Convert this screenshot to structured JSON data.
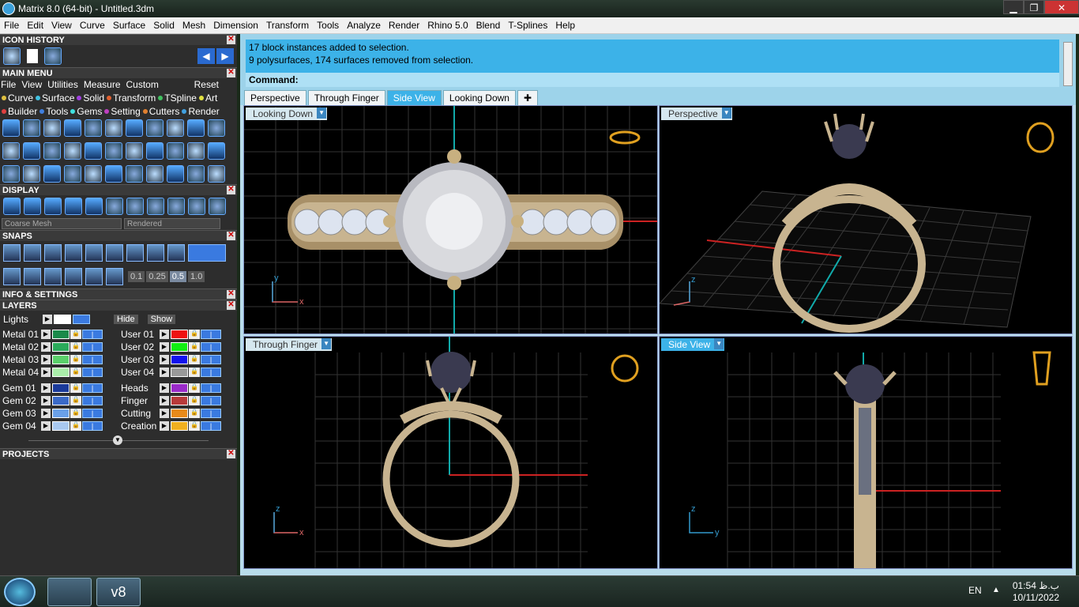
{
  "window": {
    "title": "Matrix 8.0 (64-bit) - Untitled.3dm",
    "min": "▁",
    "max": "❐",
    "close": "✕"
  },
  "menubar": [
    "File",
    "Edit",
    "View",
    "Curve",
    "Surface",
    "Solid",
    "Mesh",
    "Dimension",
    "Transform",
    "Tools",
    "Analyze",
    "Render",
    "Rhino 5.0",
    "Blend",
    "T-Splines",
    "Help"
  ],
  "left": {
    "icon_history": {
      "title": "ICON HISTORY"
    },
    "main_menu": {
      "title": "MAIN MENU",
      "menus": [
        "File",
        "View",
        "Utilities",
        "Measure",
        "Custom"
      ],
      "reset": "Reset",
      "cats_row1": [
        {
          "label": "Curve",
          "color": "#e0c040"
        },
        {
          "label": "Surface",
          "color": "#40c0e0"
        },
        {
          "label": "Solid",
          "color": "#a040e0"
        },
        {
          "label": "Transform",
          "color": "#e06030"
        },
        {
          "label": "TSpline",
          "color": "#40c060"
        },
        {
          "label": "Art",
          "color": "#e0e040"
        }
      ],
      "cats_row2": [
        {
          "label": "Builder",
          "color": "#e04040"
        },
        {
          "label": "Tools",
          "color": "#4080e0"
        },
        {
          "label": "Gems",
          "color": "#40e0e0"
        },
        {
          "label": "Setting",
          "color": "#c040c0"
        },
        {
          "label": "Cutters",
          "color": "#e08030"
        },
        {
          "label": "Render",
          "color": "#40a0e0"
        }
      ]
    },
    "display": {
      "title": "DISPLAY",
      "mesh": "Coarse Mesh",
      "mode": "Rendered"
    },
    "snaps": {
      "title": "SNAPS",
      "vals": [
        "0.1",
        "0.25",
        "0.5",
        "1.0"
      ]
    },
    "info": {
      "title": "INFO & SETTINGS"
    },
    "layers": {
      "title": "LAYERS",
      "lights": "Lights",
      "hide": "Hide",
      "show": "Show",
      "left_col": [
        {
          "name": "Metal 01",
          "color": "#1a8a4a"
        },
        {
          "name": "Metal 02",
          "color": "#2aaa5a"
        },
        {
          "name": "Metal 03",
          "color": "#5ad06a"
        },
        {
          "name": "Metal 04",
          "color": "#aaeeaa"
        },
        {
          "name": "Gem 01",
          "color": "#1a3a9a"
        },
        {
          "name": "Gem 02",
          "color": "#3a6ac8"
        },
        {
          "name": "Gem 03",
          "color": "#6aa0e8"
        },
        {
          "name": "Gem 04",
          "color": "#a8c8f0"
        }
      ],
      "right_col": [
        {
          "name": "User 01",
          "color": "#ee1111"
        },
        {
          "name": "User 02",
          "color": "#11ee11"
        },
        {
          "name": "User 03",
          "color": "#1111ee"
        },
        {
          "name": "User 04",
          "color": "#999999"
        },
        {
          "name": "Heads",
          "color": "#9a2ac8"
        },
        {
          "name": "Finger",
          "color": "#b83a3a"
        },
        {
          "name": "Cutting",
          "color": "#e88a1a"
        },
        {
          "name": "Creation",
          "color": "#f0b020"
        }
      ]
    },
    "projects": {
      "title": "PROJECTS"
    }
  },
  "command": {
    "line1": "17 block instances added to selection.",
    "line2": "9 polysurfaces, 174 surfaces removed from selection.",
    "prompt": "Command:"
  },
  "view_tabs": [
    {
      "label": "Perspective",
      "active": false
    },
    {
      "label": "Through Finger",
      "active": false
    },
    {
      "label": "Side View",
      "active": true
    },
    {
      "label": "Looking Down",
      "active": false
    }
  ],
  "add_tab": "✚",
  "viewports": {
    "tl": "Looking Down",
    "tr": "Perspective",
    "bl": "Through Finger",
    "br": "Side View"
  },
  "axes": {
    "y": "y",
    "x": "x",
    "z": "z"
  },
  "taskbar": {
    "lang": "EN",
    "tray": "▲",
    "time": "01:54 ب.ظ",
    "date": "10/11/2022",
    "app_label": "v8"
  }
}
